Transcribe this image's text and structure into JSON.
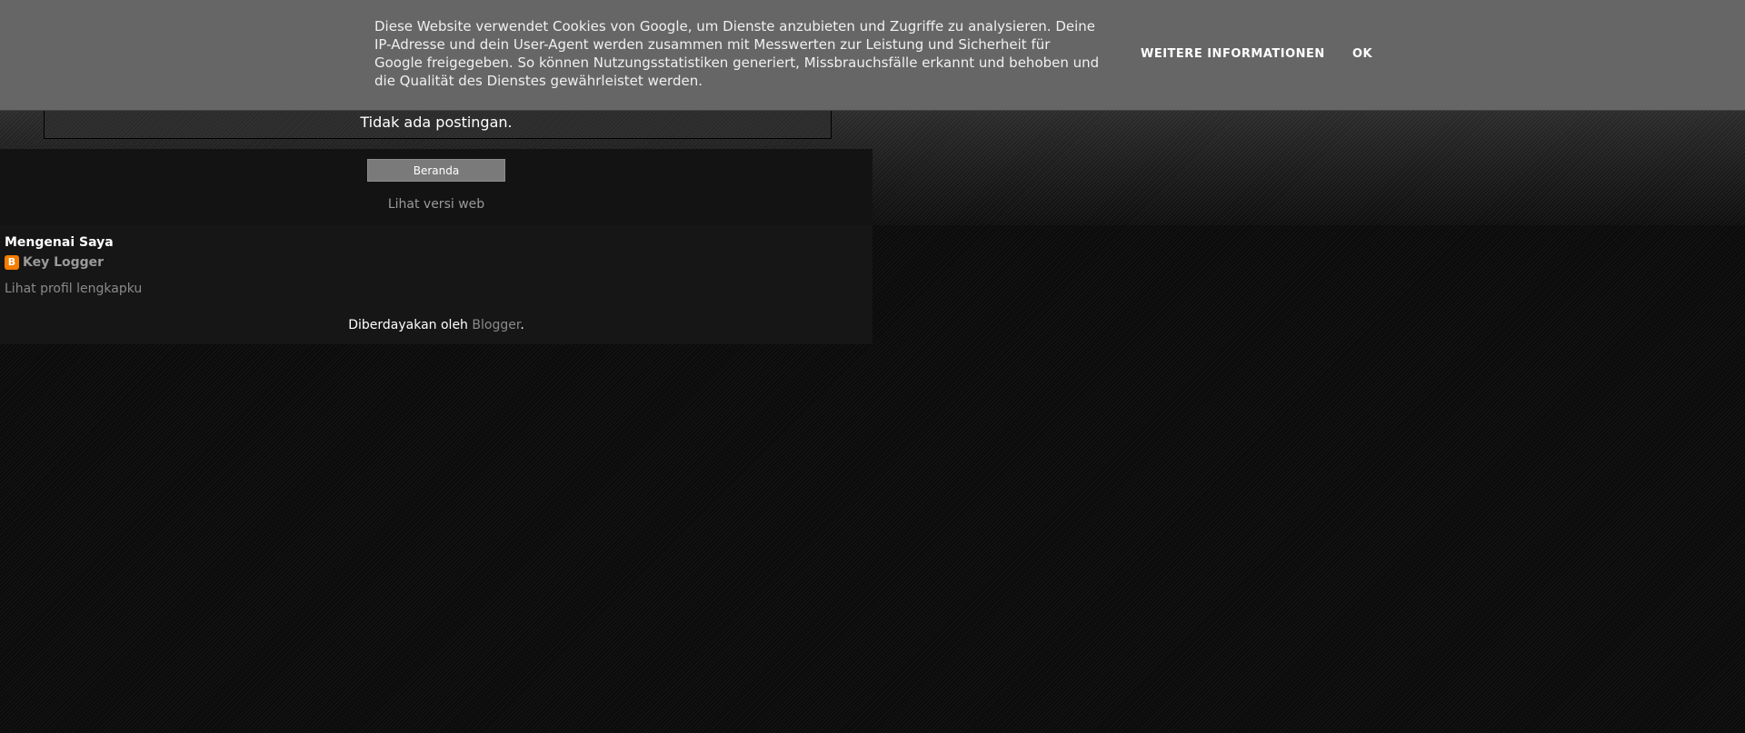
{
  "cookie_banner": {
    "text": "Diese Website verwendet Cookies von Google, um Dienste anzubieten und Zugriffe zu analysieren. Deine IP-Adresse und dein User-Agent werden zusammen mit Messwerten zur Leistung und Sicherheit für Google freigegeben. So können Nutzungsstatistiken generiert, Missbrauchsfälle erkannt und behoben und die Qualität des Dienstes gewährleistet werden.",
    "more_info_label": "WEITERE INFORMATIONEN",
    "ok_label": "OK"
  },
  "main": {
    "no_posts_text": "Tidak ada postingan."
  },
  "footer_nav": {
    "home_label": "Beranda",
    "web_version_label": "Lihat versi web"
  },
  "profile": {
    "heading": "Mengenai Saya",
    "icon": "blogger-icon",
    "icon_glyph": "B",
    "icon_color": "#f57d00",
    "name": "Key Logger",
    "profile_link": "Lihat profil lengkapku"
  },
  "attribution": {
    "prefix": "Diberdayakan oleh ",
    "link": "Blogger",
    "suffix": "."
  },
  "colors": {
    "banner_bg": "#666666",
    "page_bg": "#0a0a0a",
    "link_gray": "#8a8a8a"
  }
}
